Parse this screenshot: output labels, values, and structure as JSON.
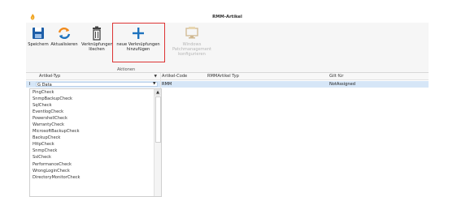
{
  "window": {
    "title": "RMM-Artikel"
  },
  "ribbon": {
    "buttons": [
      {
        "label": "Speichern",
        "icon": "save-icon",
        "enabled": true
      },
      {
        "label": "Aktualisieren",
        "icon": "refresh-icon",
        "enabled": true
      },
      {
        "label": "Verknüpfungen löschen",
        "icon": "trash-icon",
        "enabled": true
      },
      {
        "label": "neue Verknüpfungen hinzufügen",
        "icon": "plus-icon",
        "enabled": true
      },
      {
        "label": "Windows Patchmanagement konfigurieren",
        "icon": "monitor-icon",
        "enabled": false
      }
    ],
    "group_label": "Aktionen"
  },
  "grid": {
    "columns": [
      "Artikel-Typ",
      "Artikel-Code",
      "RMMArtikel Typ",
      "Gilt für"
    ],
    "rows": [
      {
        "marker": "I",
        "artikel_typ": "G Data",
        "artikel_code": "RMM",
        "rmm_typ": "",
        "gilt_fuer": "NotAssigned"
      }
    ]
  },
  "dropdown": {
    "items": [
      "PingCheck",
      "SnmpBackupCheck",
      "SqlCheck",
      "EventlogCheck",
      "PowershellCheck",
      "WarrantyCheck",
      "MicrosoftBackupCheck",
      "BackupCheck",
      "HttpCheck",
      "SnmpCheck",
      "SslCheck",
      "PerformanceCheck",
      "WrongLoginCheck",
      "DirectoryMonitorCheck"
    ]
  },
  "colors": {
    "accent": "#1e73be",
    "highlight_border": "#dd3333",
    "selected_row": "#d6e6f7"
  }
}
